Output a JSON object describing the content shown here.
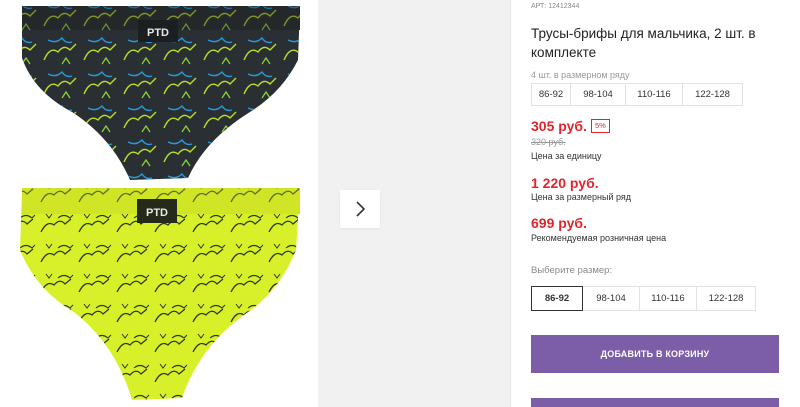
{
  "product": {
    "sku": "АРТ: 12412344",
    "title": "Трусы-брифы для мальчика, 2 шт. в комплекте",
    "image_logo": "PTD"
  },
  "pack": {
    "note": "4 шт. в размерном ряду",
    "sizes": [
      "86-92",
      "98-104",
      "110-116",
      "122-128"
    ]
  },
  "prices": {
    "unit_price": "305 руб.",
    "discount": "5%",
    "old_price": "320 руб.",
    "unit_label": "Цена за единицу",
    "size_row_price": "1 220 руб.",
    "size_row_label": "Цена за размерный ряд",
    "rrp": "699 руб.",
    "rrp_label": "Рекомендуемая розничная цена"
  },
  "size_select": {
    "label": "Выберите размер:",
    "options": [
      "86-92",
      "98-104",
      "110-116",
      "122-128"
    ],
    "selected": "86-92"
  },
  "cart": {
    "add_label": "ДОБАВИТЬ В КОРЗИНУ"
  },
  "colors": {
    "accent_red": "#e0252e",
    "button_purple": "#7b5ea7",
    "garment_dark": "#2a2f33",
    "garment_lime": "#d8f029"
  },
  "icons": {
    "next": "chevron-right-icon"
  }
}
